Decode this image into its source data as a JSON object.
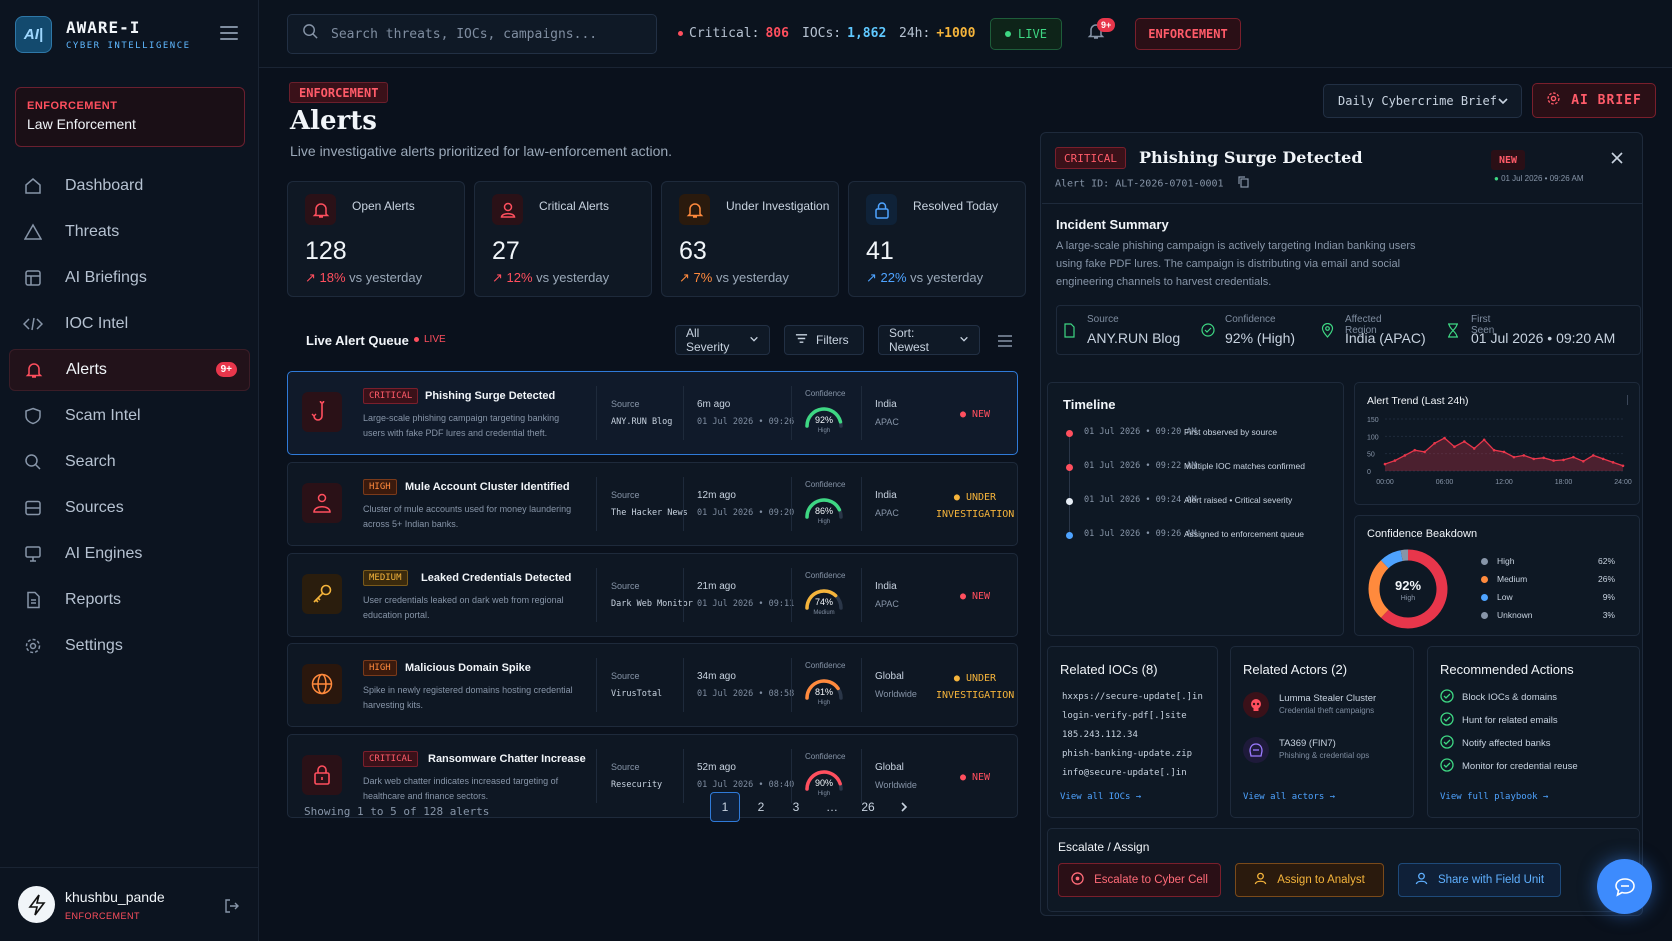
{
  "brand": {
    "logo": "AI|",
    "name": "AWARE-I",
    "subtitle": "CYBER INTELLIGENCE"
  },
  "role": {
    "tag": "ENFORCEMENT",
    "name": "Law Enforcement"
  },
  "nav": [
    {
      "label": "Dashboard",
      "icon": "home-icon"
    },
    {
      "label": "Threats",
      "icon": "warning-icon"
    },
    {
      "label": "AI Briefings",
      "icon": "grid-icon"
    },
    {
      "label": "IOC Intel",
      "icon": "code-icon"
    },
    {
      "label": "Alerts",
      "icon": "bell-icon",
      "badge": "9+",
      "active": true
    },
    {
      "label": "Scam Intel",
      "icon": "shield-icon"
    },
    {
      "label": "Search",
      "icon": "search-icon"
    },
    {
      "label": "Sources",
      "icon": "database-icon"
    },
    {
      "label": "AI Engines",
      "icon": "monitor-icon"
    },
    {
      "label": "Reports",
      "icon": "document-icon"
    },
    {
      "label": "Settings",
      "icon": "gear-icon"
    }
  ],
  "user": {
    "name": "khushbu_pande",
    "role": "ENFORCEMENT"
  },
  "topbar": {
    "search_placeholder": "Search threats, IOCs, campaigns...",
    "critical_label": "Critical:",
    "critical_value": "806",
    "iocs_label": "IOCs:",
    "iocs_value": "1,862",
    "h24_label": "24h:",
    "h24_value": "+1000",
    "live": "LIVE",
    "notif_badge": "9+",
    "enforcement": "ENFORCEMENT"
  },
  "header": {
    "tag": "ENFORCEMENT",
    "title": "Alerts",
    "subtitle": "Live investigative alerts prioritized for law-enforcement action.",
    "brief_select": "Daily Cybercrime Brief",
    "ai_brief": "AI BRIEF"
  },
  "kpis": [
    {
      "label": "Open Alerts",
      "value": "128",
      "delta": "18%",
      "suffix": "vs yesterday",
      "color": "#ff4f5e"
    },
    {
      "label": "Critical Alerts",
      "value": "27",
      "delta": "12%",
      "suffix": "vs yesterday",
      "color": "#ff4f5e"
    },
    {
      "label": "Under Investigation",
      "value": "63",
      "delta": "7%",
      "suffix": "vs yesterday",
      "color": "#ff8a3d"
    },
    {
      "label": "Resolved Today",
      "value": "41",
      "delta": "22%",
      "suffix": "vs yesterday",
      "color": "#4ea3ff"
    }
  ],
  "queue": {
    "title": "Live Alert Queue",
    "live": "LIVE",
    "severity_filter": "All Severity",
    "filters": "Filters",
    "sort": "Sort: Newest",
    "source_label": "Source",
    "confidence_label": "Confidence",
    "alerts": [
      {
        "severity": "CRITICAL",
        "sev_class": "critical",
        "title": "Phishing Surge Detected",
        "desc": "Large-scale phishing campaign targeting banking users with fake PDF lures and credential theft.",
        "source": "ANY.RUN Blog",
        "ago": "6m ago",
        "date": "01 Jul 2026 • 09:26",
        "confidence": 92,
        "conf_level": "High",
        "conf_color": "#3ed783",
        "region": "India",
        "region2": "APAC",
        "status": "NEW",
        "status_color": "#ff4f5e"
      },
      {
        "severity": "HIGH",
        "sev_class": "high",
        "title": "Mule Account Cluster Identified",
        "desc": "Cluster of mule accounts used for money laundering across 5+ Indian banks.",
        "source": "The Hacker News",
        "ago": "12m ago",
        "date": "01 Jul 2026 • 09:20",
        "confidence": 86,
        "conf_level": "High",
        "conf_color": "#3ed783",
        "region": "India",
        "region2": "APAC",
        "status": "UNDER INVESTIGATION",
        "status_color": "#f5b43b"
      },
      {
        "severity": "MEDIUM",
        "sev_class": "medium",
        "title": "Leaked Credentials Detected",
        "desc": "User credentials leaked on dark web from regional education portal.",
        "source": "Dark Web Monitor",
        "ago": "21m ago",
        "date": "01 Jul 2026 • 09:11",
        "confidence": 74,
        "conf_level": "Medium",
        "conf_color": "#f5b43b",
        "region": "India",
        "region2": "APAC",
        "status": "NEW",
        "status_color": "#ff4f5e"
      },
      {
        "severity": "HIGH",
        "sev_class": "high",
        "title": "Malicious Domain Spike",
        "desc": "Spike in newly registered domains hosting credential harvesting kits.",
        "source": "VirusTotal",
        "ago": "34m ago",
        "date": "01 Jul 2026 • 08:58",
        "confidence": 81,
        "conf_level": "High",
        "conf_color": "#ff8a3d",
        "region": "Global",
        "region2": "Worldwide",
        "status": "UNDER INVESTIGATION",
        "status_color": "#f5b43b"
      },
      {
        "severity": "CRITICAL",
        "sev_class": "critical",
        "title": "Ransomware Chatter Increase",
        "desc": "Dark web chatter indicates increased targeting of healthcare and finance sectors.",
        "source": "Resecurity",
        "ago": "52m ago",
        "date": "01 Jul 2026 • 08:40",
        "confidence": 90,
        "conf_level": "High",
        "conf_color": "#ff4f5e",
        "region": "Global",
        "region2": "Worldwide",
        "status": "NEW",
        "status_color": "#ff4f5e"
      }
    ],
    "showing": "Showing 1 to 5 of 128 alerts",
    "pages": [
      "1",
      "2",
      "3",
      "…",
      "26"
    ]
  },
  "detail": {
    "severity": "CRITICAL",
    "title": "Phishing Surge Detected",
    "alert_id": "Alert ID: ALT-2026-0701-0001",
    "status": "NEW",
    "timestamp": "01 Jul 2026 • 09:26 AM",
    "summary_title": "Incident Summary",
    "summary": "A large-scale phishing campaign is actively targeting Indian banking users using fake PDF lures. The campaign is distributing via email and social engineering channels to harvest credentials.",
    "meta": [
      {
        "label": "Source",
        "value": "ANY.RUN Blog"
      },
      {
        "label": "Confidence",
        "value": "92% (High)"
      },
      {
        "label": "Affected Region",
        "value": "India (APAC)"
      },
      {
        "label": "First Seen",
        "value": "01 Jul 2026 • 09:20 AM"
      }
    ],
    "timeline_title": "Timeline",
    "timeline": [
      {
        "date": "01 Jul 2026 • 09:20 AM",
        "event": "First observed by source",
        "color": "#ff4f5e"
      },
      {
        "date": "01 Jul 2026 • 09:22 AM",
        "event": "Multiple IOC matches confirmed",
        "color": "#ff4f5e"
      },
      {
        "date": "01 Jul 2026 • 09:24 AM",
        "event": "Alert raised • Critical severity",
        "color": "#e6edf5"
      },
      {
        "date": "01 Jul 2026 • 09:26 AM",
        "event": "Assigned to enforcement queue",
        "color": "#4ea3ff"
      }
    ],
    "trend_title": "Alert Trend (Last 24h)",
    "breakdown_title": "Confidence Beakdown",
    "breakdown_center": "92%",
    "breakdown_center_sub": "High",
    "iocs_title": "Related IOCs (8)",
    "iocs": [
      "hxxps://secure-update[.]in",
      "login-verify-pdf[.]site",
      "185.243.112.34",
      "phish-banking-update.zip",
      "info@secure-update[.]in"
    ],
    "iocs_link": "View all IOCs →",
    "actors_title": "Related Actors (2)",
    "actors": [
      {
        "name": "Lumma Stealer Cluster",
        "desc": "Credential theft campaigns"
      },
      {
        "name": "TA369 (FIN7)",
        "desc": "Phishing & credential ops"
      }
    ],
    "actors_link": "View all actors →",
    "actions_title": "Recommended Actions",
    "actions": [
      "Block IOCs & domains",
      "Hunt for related emails",
      "Notify affected banks",
      "Monitor for credential reuse"
    ],
    "actions_link": "View full playbook →",
    "escalate_title": "Escalate / Assign",
    "escalate_buttons": [
      "Escalate to Cyber Cell",
      "Assign to Analyst",
      "Share with Field Unit"
    ]
  },
  "chart_data": [
    {
      "type": "area",
      "title": "Alert Trend (Last 24h)",
      "x_ticks": [
        "00:00",
        "06:00",
        "12:00",
        "18:00",
        "24:00"
      ],
      "y_ticks": [
        0,
        50,
        100,
        150
      ],
      "ylim": [
        0,
        150
      ],
      "x": [
        0,
        1,
        2,
        3,
        4,
        5,
        6,
        7,
        8,
        9,
        10,
        11,
        12,
        13,
        14,
        15,
        16,
        17,
        18,
        19,
        20,
        21,
        22,
        23,
        24
      ],
      "values": [
        20,
        30,
        45,
        60,
        55,
        80,
        95,
        70,
        85,
        65,
        90,
        60,
        55,
        40,
        45,
        35,
        38,
        30,
        32,
        40,
        28,
        45,
        35,
        25,
        15
      ],
      "color": "#e8364b",
      "grid": true
    },
    {
      "type": "pie",
      "title": "Confidence Beakdown",
      "labels": [
        "High",
        "Medium",
        "Low",
        "Unknown"
      ],
      "values": [
        62,
        26,
        9,
        3
      ],
      "display": [
        "62%",
        "26%",
        "9%",
        "3%"
      ],
      "colors": [
        "#e8364b",
        "#ff8a3d",
        "#4ea3ff",
        "#8795a8"
      ],
      "donut": true,
      "legend": "right"
    }
  ]
}
